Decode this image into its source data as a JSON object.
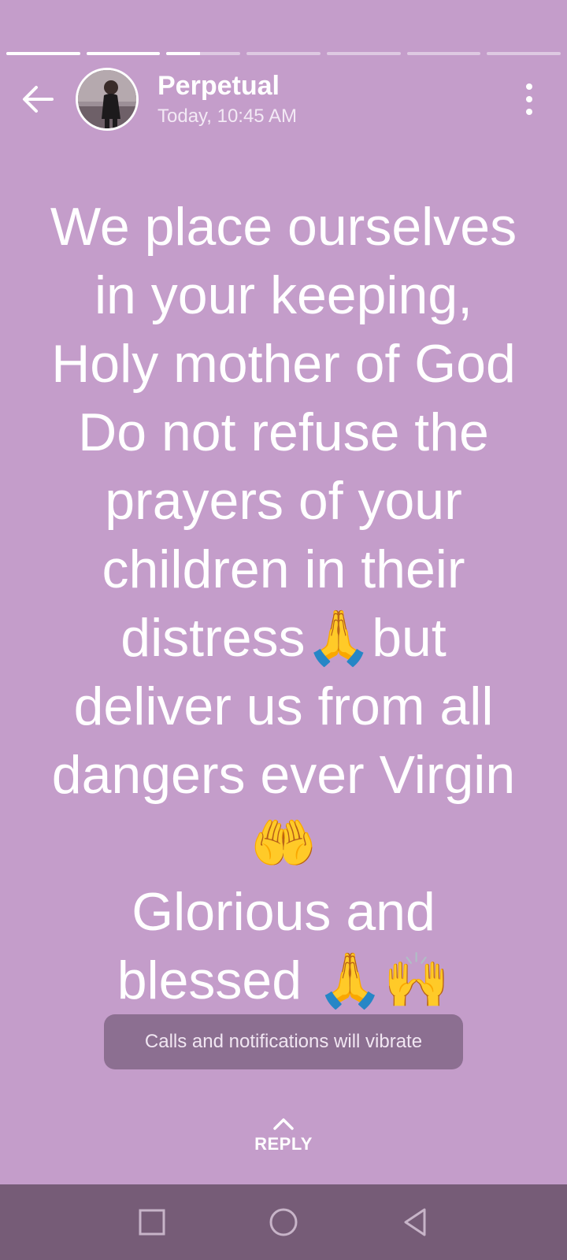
{
  "story": {
    "segment_count": 7,
    "segments": [
      1,
      1,
      0.45,
      0,
      0,
      0,
      0
    ],
    "background": "#c49dca"
  },
  "header": {
    "name": "Perpetual",
    "time": "Today, 10:45 AM",
    "back_icon": "arrow-left-icon",
    "more_icon": "more-vertical-icon"
  },
  "status": {
    "lines": [
      "We place ourselves",
      "in your keeping,",
      "Holy mother of God",
      "Do not refuse the",
      "prayers of your",
      "children in their",
      "distress🙏but",
      "deliver us from all",
      "dangers ever Virgin",
      "🤲",
      "Glorious and",
      "blessed 🙏🙌"
    ]
  },
  "toast": {
    "text": "Calls and notifications will vibrate"
  },
  "reply": {
    "label": "REPLY",
    "icon": "chevron-up-icon"
  },
  "navbar": {
    "background": "#765c77",
    "items": [
      "square-recents-icon",
      "circle-home-icon",
      "triangle-back-icon"
    ]
  }
}
